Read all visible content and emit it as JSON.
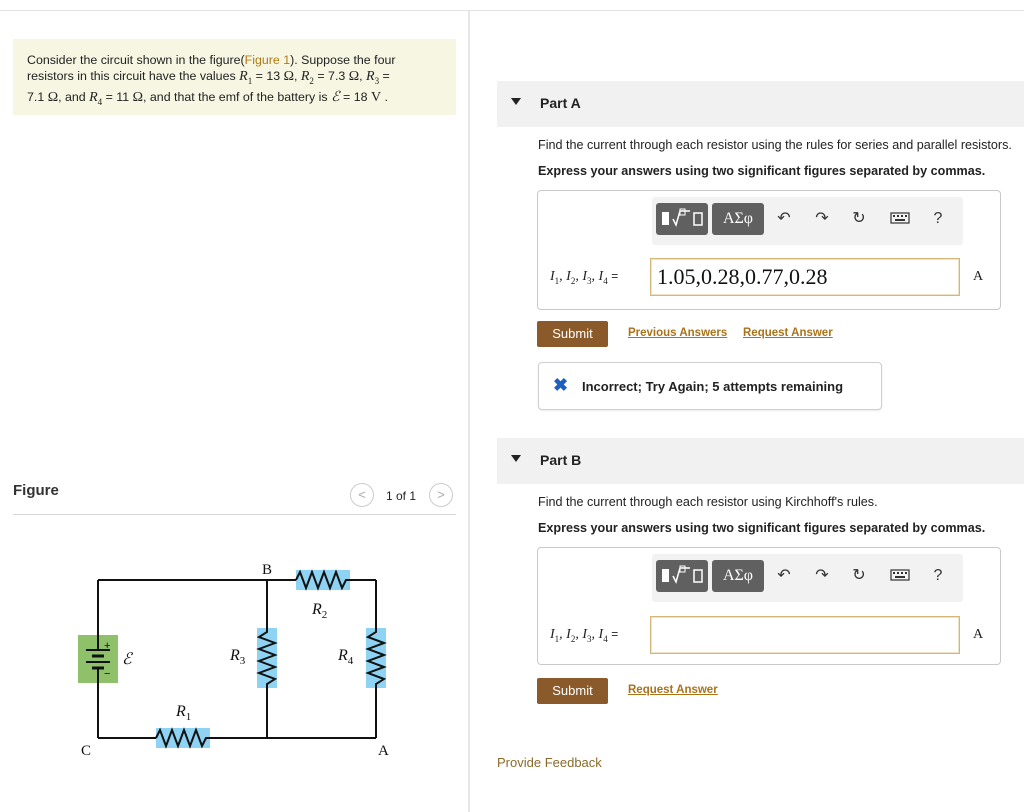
{
  "problem": {
    "intro": "Consider the circuit shown in the figure(",
    "figure_link": "Figure 1",
    "after_link": "). Suppose the four",
    "line2_start": "resistors in this circuit have the values",
    "r1_val": "= 13",
    "r2_val": "= 7.3",
    "r3_val": "=",
    "line3_r3": "7.1",
    "r4_val": "= 11",
    "and_text": ", and",
    "battery_text": ", and that the emf of the battery is",
    "emf_val": "= 18",
    "ohm": "Ω",
    "volt": "V"
  },
  "figure": {
    "label": "Figure",
    "counter": "1 of 1",
    "prev_glyph": "<",
    "next_glyph": ">",
    "circuit_labels": {
      "B": "B",
      "C": "C",
      "A": "A",
      "R1": "R",
      "R1_sub": "1",
      "R2": "R",
      "R2_sub": "2",
      "R3": "R",
      "R3_sub": "3",
      "R4": "R",
      "R4_sub": "4",
      "emf": "ℰ",
      "plus": "+",
      "minus": "−"
    }
  },
  "partA": {
    "title": "Part A",
    "question": "Find the current through each resistor using the rules for series and parallel resistors.",
    "instruction": "Express your answers using two significant figures separated by commas.",
    "toolbar_greek": "ΑΣφ",
    "help": "?",
    "var_label": "I1, I2, I3, I4 =",
    "answer_value": "1.05,0.28,0.77,0.28",
    "unit": "A",
    "submit": "Submit",
    "previous_answers": "Previous Answers",
    "request_answer": "Request Answer",
    "feedback": "Incorrect; Try Again; 5 attempts remaining"
  },
  "partB": {
    "title": "Part B",
    "question": "Find the current through each resistor using Kirchhoff's rules.",
    "instruction": "Express your answers using two significant figures separated by commas.",
    "toolbar_greek": "ΑΣφ",
    "help": "?",
    "var_label": "I1, I2, I3, I4 =",
    "answer_value": "",
    "unit": "A",
    "submit": "Submit",
    "request_answer": "Request Answer"
  },
  "footer": {
    "provide_feedback": "Provide Feedback"
  },
  "colors": {
    "submit": "#8b5a2b",
    "link": "#a9731a",
    "resistor_highlight": "#8fd3f4",
    "battery_highlight": "#8fc06a"
  }
}
